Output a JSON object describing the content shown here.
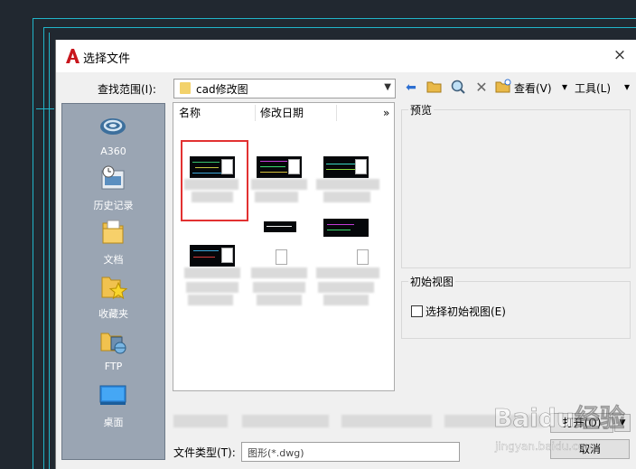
{
  "dialog": {
    "title": "选择文件",
    "close_glyph": "×"
  },
  "lookin": {
    "label": "查找范围(I):",
    "value": "cad修改图"
  },
  "toolbar": {
    "view_label": "查看(V)",
    "tools_label": "工具(L)"
  },
  "places": [
    {
      "label": "A360",
      "icon": "cloud-icon"
    },
    {
      "label": "历史记录",
      "icon": "history-icon"
    },
    {
      "label": "文档",
      "icon": "documents-icon"
    },
    {
      "label": "收藏夹",
      "icon": "favorites-icon"
    },
    {
      "label": "FTP",
      "icon": "ftp-icon"
    },
    {
      "label": "桌面",
      "icon": "desktop-icon"
    }
  ],
  "filelist": {
    "columns": [
      "名称",
      "修改日期"
    ],
    "more": "»"
  },
  "preview": {
    "label": "预览"
  },
  "initial_view": {
    "group_label": "初始视图",
    "checkbox_label": "选择初始视图(E)"
  },
  "file_type": {
    "label": "文件类型(T):",
    "value": "图形(*.dwg)"
  },
  "buttons": {
    "open": "打开(O)",
    "cancel": "取消"
  },
  "watermark": {
    "line1": "Baidu经验",
    "line2": "jingyan.baidu.com"
  },
  "colors": {
    "cad_accent": "#21b5c9",
    "selection": "#e23131",
    "places_bg": "#9aa5b3"
  }
}
